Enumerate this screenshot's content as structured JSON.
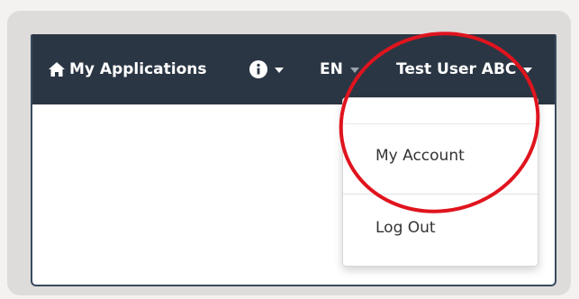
{
  "navbar": {
    "home_label": "My Applications",
    "language_label": "EN",
    "user_label": "Test User ABC"
  },
  "dropdown": {
    "items": [
      {
        "label": "My Account"
      },
      {
        "label": "Log Out"
      }
    ]
  },
  "colors": {
    "navbar_bg": "#2b3644",
    "highlight_ring": "#e0141e",
    "dropdown_text": "#333333"
  },
  "icons": {
    "home": "home-icon",
    "info": "info-icon",
    "caret": "caret-down-icon"
  }
}
